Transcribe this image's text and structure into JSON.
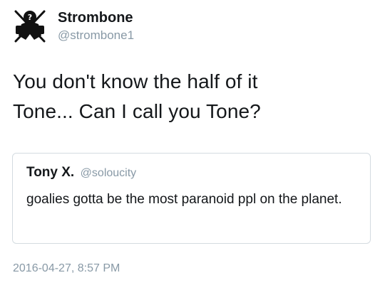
{
  "tweet": {
    "author": {
      "display_name": "Strombone",
      "handle": "@strombone1",
      "avatar_icon": "goalie-avatar-icon"
    },
    "text": "You don't know the half of it\nTone... Can I call you Tone?",
    "quoted_tweet": {
      "display_name": "Tony X.",
      "handle": "@soloucity",
      "text": "goalies gotta be the most paranoid ppl on the planet."
    },
    "timestamp": "2016-04-27, 8:57 PM"
  },
  "colors": {
    "text_primary": "#14171a",
    "text_secondary": "#8899a6",
    "card_border": "#d4dbe0",
    "avatar": "#111111"
  }
}
